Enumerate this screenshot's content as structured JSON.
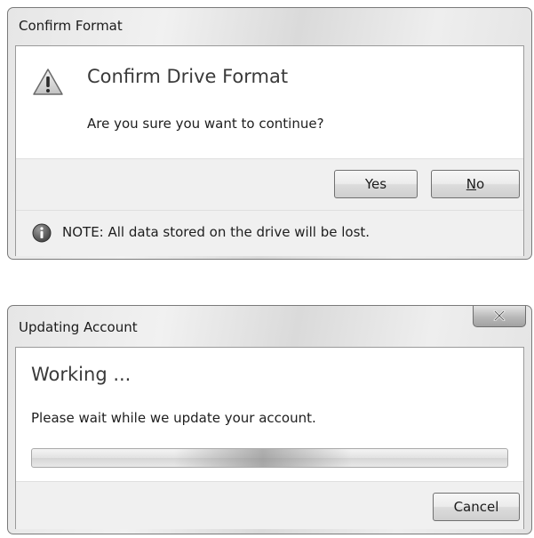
{
  "dialogs": [
    {
      "title": "Confirm Format",
      "main_instruction": "Confirm Drive Format",
      "content": "Are you sure you want to continue?",
      "warning_icon": "warning-icon",
      "buttons": {
        "yes": "Yes",
        "no_accel": "N",
        "no_rest": "o"
      },
      "footnote": {
        "icon": "info-icon",
        "text": "NOTE: All data stored on the drive will be lost."
      }
    },
    {
      "title": "Updating Account",
      "close_icon": "close-icon",
      "main_instruction": "Working ...",
      "content": "Please wait while we update your account.",
      "progress": {
        "style": "marquee"
      },
      "buttons": {
        "cancel": "Cancel"
      }
    }
  ]
}
